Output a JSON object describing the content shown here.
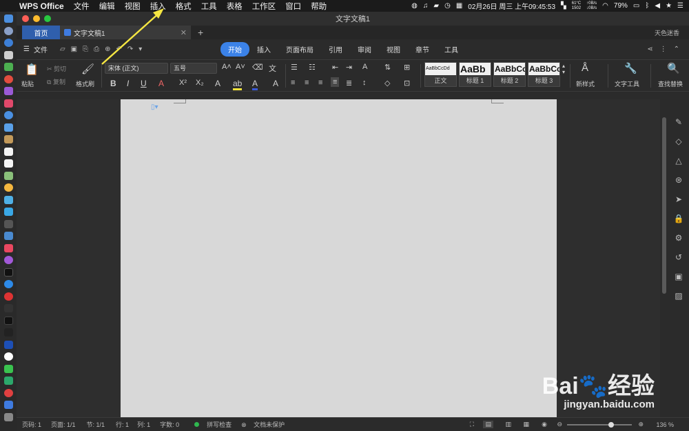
{
  "menubar": {
    "app_name": "WPS Office",
    "items": [
      "文件",
      "编辑",
      "视图",
      "插入",
      "格式",
      "工具",
      "表格",
      "工作区",
      "窗口",
      "帮助"
    ],
    "datetime": "02月26日 周三 上午09:45:53",
    "temp": [
      "61°C",
      "1502"
    ],
    "net": [
      "↑0B/s",
      "↓0B/s"
    ],
    "battery": "79%"
  },
  "window": {
    "title": "文字文稿1",
    "tabs": {
      "home": "首页",
      "doc": "文字文稿1"
    },
    "user": "天色迷香"
  },
  "ribbon": {
    "file_label": "文件",
    "tabs": [
      "开始",
      "插入",
      "页面布局",
      "引用",
      "审阅",
      "视图",
      "章节",
      "工具"
    ],
    "active_tab": "开始"
  },
  "toolbar": {
    "paste": "粘贴",
    "cut": "剪切",
    "copy": "复制",
    "format_painter": "格式刷",
    "font": "宋体 (正文)",
    "font_size": "五号",
    "styles": [
      {
        "preview": "AaBbCcDd",
        "label": "正文"
      },
      {
        "preview": "AaBb",
        "label": "标题 1"
      },
      {
        "preview": "AaBbCc",
        "label": "标题 2"
      },
      {
        "preview": "AaBbCc",
        "label": "标题 3"
      }
    ],
    "new_style": "新样式",
    "text_tools": "文字工具",
    "find_replace": "查找替换"
  },
  "status": {
    "page_code": "页码: 1",
    "page": "页面: 1/1",
    "section": "节: 1/1",
    "row": "行: 1",
    "col": "列: 1",
    "words": "字数: 0",
    "spell": "拼写检查",
    "protect": "文档未保护",
    "zoom": "136 %"
  },
  "watermark": {
    "brand": "Bai",
    "brand2": "经验",
    "url": "jingyan.baidu.com"
  },
  "colors": {
    "accent": "#3b82e8",
    "arrow": "#f5e642",
    "home_tab": "#2f5fad"
  }
}
